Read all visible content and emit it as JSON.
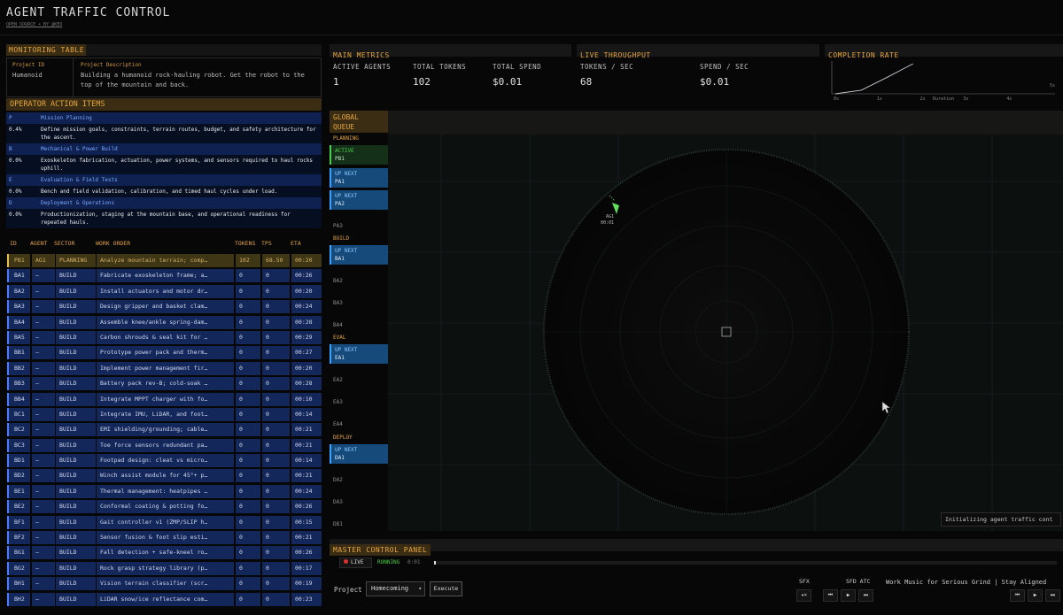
{
  "header": {
    "title": "AGENT TRAFFIC CONTROL",
    "subtitle": "OPEN SOURCE • BY @KEO"
  },
  "monitoring": {
    "title": "MONITORING TABLE",
    "project_id_label": "Project ID",
    "project_id": "Humanoid",
    "desc_label": "Project Description",
    "description": "Building a humanoid rock-hauling robot. Get the robot to the top of the mountain and back."
  },
  "operator": {
    "title": "OPERATOR ACTION ITEMS",
    "items": [
      {
        "key": "P",
        "title": "Mission Planning",
        "pct": "0.4%",
        "text": "Define mission goals, constraints, terrain routes, budget, and safety architecture for the ascent."
      },
      {
        "key": "B",
        "title": "Mechanical & Power Build",
        "pct": "0.0%",
        "text": "Exoskeleton fabrication, actuation, power systems, and sensors required to haul rocks uphill."
      },
      {
        "key": "E",
        "title": "Evaluation & Field Tests",
        "pct": "0.0%",
        "text": "Bench and field validation, calibration, and timed haul cycles under load."
      },
      {
        "key": "D",
        "title": "Deployment & Operations",
        "pct": "0.0%",
        "text": "Productionization, staging at the mountain base, and operational readiness for repeated hauls."
      }
    ]
  },
  "table": {
    "headers": {
      "id": "ID",
      "agent": "AGENT",
      "sector": "SECTOR",
      "work": "WORK ORDER",
      "tokens": "TOKENS",
      "tps": "TPS",
      "eta": "ETA"
    },
    "rows": [
      {
        "id": "PB1",
        "agent": "AG1",
        "sector": "PLANNING",
        "work": "Analyze mountain terrain; comp…",
        "tokens": "102",
        "tps": "68.50",
        "eta": "00:20",
        "active": true
      },
      {
        "id": "BA1",
        "agent": "—",
        "sector": "BUILD",
        "work": "Fabricate exoskeleton frame; a…",
        "tokens": "0",
        "tps": "0",
        "eta": "00:26"
      },
      {
        "id": "BA2",
        "agent": "—",
        "sector": "BUILD",
        "work": "Install actuators and motor dr…",
        "tokens": "0",
        "tps": "0",
        "eta": "00:20"
      },
      {
        "id": "BA3",
        "agent": "—",
        "sector": "BUILD",
        "work": "Design gripper and basket clam…",
        "tokens": "0",
        "tps": "0",
        "eta": "00:24"
      },
      {
        "id": "BA4",
        "agent": "—",
        "sector": "BUILD",
        "work": "Assemble knee/ankle spring-dam…",
        "tokens": "0",
        "tps": "0",
        "eta": "00:28"
      },
      {
        "id": "BA5",
        "agent": "—",
        "sector": "BUILD",
        "work": "Carbon shrouds & seal kit for …",
        "tokens": "0",
        "tps": "0",
        "eta": "00:29"
      },
      {
        "id": "BB1",
        "agent": "—",
        "sector": "BUILD",
        "work": "Prototype power pack and therm…",
        "tokens": "0",
        "tps": "0",
        "eta": "00:27"
      },
      {
        "id": "BB2",
        "agent": "—",
        "sector": "BUILD",
        "work": "Implement power management fir…",
        "tokens": "0",
        "tps": "0",
        "eta": "00:20"
      },
      {
        "id": "BB3",
        "agent": "—",
        "sector": "BUILD",
        "work": "Battery pack rev-B; cold-soak …",
        "tokens": "0",
        "tps": "0",
        "eta": "00:28"
      },
      {
        "id": "BB4",
        "agent": "—",
        "sector": "BUILD",
        "work": "Integrate MPPT charger with fo…",
        "tokens": "0",
        "tps": "0",
        "eta": "00:10"
      },
      {
        "id": "BC1",
        "agent": "—",
        "sector": "BUILD",
        "work": "Integrate IMU, LiDAR, and foot…",
        "tokens": "0",
        "tps": "0",
        "eta": "00:14"
      },
      {
        "id": "BC2",
        "agent": "—",
        "sector": "BUILD",
        "work": "EMI shielding/grounding; cable…",
        "tokens": "0",
        "tps": "0",
        "eta": "00:21"
      },
      {
        "id": "BC3",
        "agent": "—",
        "sector": "BUILD",
        "work": "Toe force sensors redundant pa…",
        "tokens": "0",
        "tps": "0",
        "eta": "00:21"
      },
      {
        "id": "BD1",
        "agent": "—",
        "sector": "BUILD",
        "work": "Footpad design: cleat vs micro…",
        "tokens": "0",
        "tps": "0",
        "eta": "00:14"
      },
      {
        "id": "BD2",
        "agent": "—",
        "sector": "BUILD",
        "work": "Winch assist module for 45°+ p…",
        "tokens": "0",
        "tps": "0",
        "eta": "00:21"
      },
      {
        "id": "BE1",
        "agent": "—",
        "sector": "BUILD",
        "work": "Thermal management: heatpipes …",
        "tokens": "0",
        "tps": "0",
        "eta": "00:24"
      },
      {
        "id": "BE2",
        "agent": "—",
        "sector": "BUILD",
        "work": "Conformal coating & potting fo…",
        "tokens": "0",
        "tps": "0",
        "eta": "00:26"
      },
      {
        "id": "BF1",
        "agent": "—",
        "sector": "BUILD",
        "work": "Gait controller v1 (ZMP/SLIP h…",
        "tokens": "0",
        "tps": "0",
        "eta": "00:15"
      },
      {
        "id": "BF2",
        "agent": "—",
        "sector": "BUILD",
        "work": "Sensor fusion & foot slip esti…",
        "tokens": "0",
        "tps": "0",
        "eta": "00:21"
      },
      {
        "id": "BG1",
        "agent": "—",
        "sector": "BUILD",
        "work": "Fall detection + safe-kneel ro…",
        "tokens": "0",
        "tps": "0",
        "eta": "00:26"
      },
      {
        "id": "BG2",
        "agent": "—",
        "sector": "BUILD",
        "work": "Rock grasp strategy library (p…",
        "tokens": "0",
        "tps": "0",
        "eta": "00:17"
      },
      {
        "id": "BH1",
        "agent": "—",
        "sector": "BUILD",
        "work": "Vision terrain classifier (scr…",
        "tokens": "0",
        "tps": "0",
        "eta": "00:19"
      },
      {
        "id": "BH2",
        "agent": "—",
        "sector": "BUILD",
        "work": "LiDAR snow/ice reflectance com…",
        "tokens": "0",
        "tps": "0",
        "eta": "00:23"
      }
    ]
  },
  "metrics": {
    "main_title": "MAIN METRICS",
    "live_title": "LIVE THROUGHPUT",
    "active_agents_label": "ACTIVE AGENTS",
    "active_agents": "1",
    "total_tokens_label": "TOTAL TOKENS",
    "total_tokens": "102",
    "total_spend_label": "TOTAL SPEND",
    "total_spend": "$0.01",
    "tokens_sec_label": "TOKENS / SEC",
    "tokens_sec": "68",
    "spend_sec_label": "SPEND / SEC",
    "spend_sec": "$0.01"
  },
  "completion": {
    "title": "COMPLETION RATE",
    "ticks": [
      "0s",
      "1s",
      "2s",
      "3s",
      "4s",
      "5s"
    ],
    "axis_label": "Duration",
    "chart_data": {
      "type": "line",
      "title": "COMPLETION RATE",
      "xlabel": "Duration",
      "x": [
        0,
        0.6,
        1.2,
        1.8
      ],
      "y": [
        0,
        0.12,
        0.55,
        1.0
      ]
    }
  },
  "queue": {
    "title_line1": "GLOBAL",
    "title_line2": "QUEUE",
    "groups": {
      "planning": "PLANNING",
      "build": "BUILD",
      "eval": "EVAL",
      "deploy": "DEPLOY"
    },
    "status": {
      "active": "ACTIVE",
      "next": "UP NEXT"
    },
    "items": {
      "pb1": "PB1",
      "pa1": "PA1",
      "pa2": "PA2",
      "pa3": "PA3",
      "ba1": "BA1",
      "ba2": "BA2",
      "ba3": "BA3",
      "ba4": "BA4",
      "ea1": "EA1",
      "ea2": "EA2",
      "ea3": "EA3",
      "ea4": "EA4",
      "da1": "DA1",
      "da2": "DA2",
      "da3": "DA3",
      "db1": "DB1"
    }
  },
  "radar": {
    "agent_label": "AG1",
    "agent_time": "00:01",
    "toast": "Initializing agent traffic cont"
  },
  "master": {
    "title": "MASTER CONTROL PANEL",
    "live": "LIVE",
    "running": "RUNNING",
    "elapsed": "0:01",
    "project_label": "Project",
    "project_value": "Homecoming",
    "execute": "Execute",
    "sfx": "SFX",
    "sfd_atc": "SFD ATC",
    "music": "Work Music for Serious Grind | Stay Aligned",
    "prev": "⏮",
    "play": "▶",
    "next": "⏭",
    "vol": "◂×"
  },
  "colors": {
    "accent": "#e5a53a",
    "row_blue": "#14275a",
    "active_row": "#3f3615",
    "queue_next": "#164a7a",
    "radar_green": "#4ad04a"
  }
}
